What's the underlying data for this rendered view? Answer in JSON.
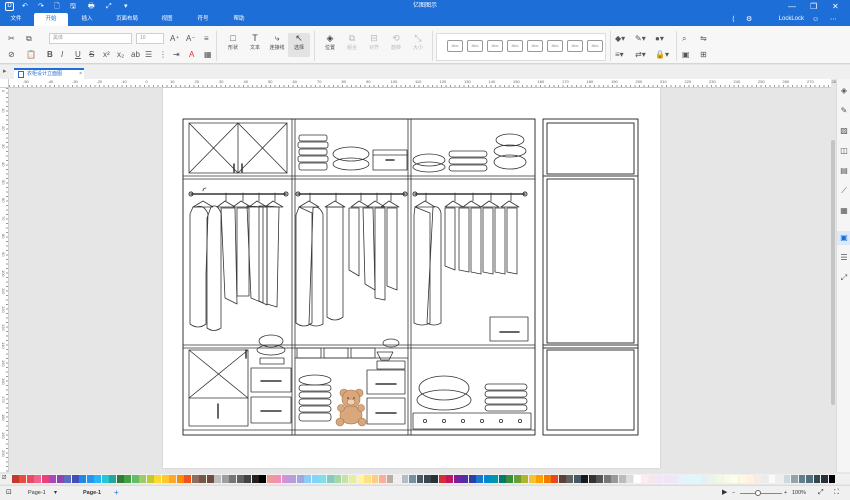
{
  "app": {
    "title": "亿图图示",
    "logo": "D",
    "quick_access": [
      "↶",
      "↷",
      "🗋",
      "🖫",
      "🖶",
      "⤢",
      "▾"
    ]
  },
  "menu": {
    "tabs": [
      "文件",
      "开始",
      "插入",
      "页面布局",
      "视图",
      "符号",
      "帮助"
    ],
    "active": "开始",
    "user": "LockLock",
    "icons": [
      "share-icon",
      "settings-icon",
      "user-icon",
      "apps-icon"
    ]
  },
  "ribbon": {
    "font_family": "黑体",
    "font_size": "10",
    "tools": [
      {
        "label": "形状",
        "icon": "□"
      },
      {
        "label": "文本",
        "icon": "T"
      },
      {
        "label": "连接线",
        "icon": "⤷"
      },
      {
        "label": "选择",
        "icon": "↖"
      },
      {
        "label": "位置",
        "icon": "◈"
      },
      {
        "label": "组合",
        "icon": "⧉"
      },
      {
        "label": "对齐",
        "icon": "⊟"
      },
      {
        "label": "旋转",
        "icon": "⟲"
      },
      {
        "label": "大小",
        "icon": "⤡"
      }
    ],
    "style_presets": [
      "Abc",
      "Abc",
      "Abc",
      "Abc",
      "Abc",
      "Abc",
      "Abc",
      "Abc"
    ]
  },
  "document": {
    "tab_name": "衣柜设计立面图"
  },
  "ruler": {
    "h_labels": [
      "-50",
      "-40",
      "-30",
      "-20",
      "-10",
      "0",
      "10",
      "20",
      "30",
      "40",
      "50",
      "60",
      "70",
      "80",
      "90",
      "100",
      "110",
      "120",
      "130",
      "140",
      "150",
      "160",
      "170",
      "180",
      "190",
      "200",
      "210",
      "220",
      "230",
      "240",
      "250",
      "260",
      "270",
      "280"
    ],
    "v_labels": [
      "0",
      "10",
      "20",
      "30",
      "40",
      "50",
      "60",
      "70",
      "80",
      "90",
      "100",
      "110",
      "120",
      "130",
      "140",
      "150",
      "160",
      "170",
      "180",
      "190",
      "200"
    ]
  },
  "sidebar": {
    "icons": [
      "fill-icon",
      "line-icon",
      "image-icon",
      "layers-icon",
      "page-icon",
      "chart-icon",
      "properties-icon",
      "list-icon",
      "expand-icon"
    ],
    "active_index": 6
  },
  "palette": {
    "colors": [
      "#c0392b",
      "#e74c3c",
      "#e84a5f",
      "#f06292",
      "#ec407a",
      "#ab47bc",
      "#8e44ad",
      "#5c6bc0",
      "#3f51b5",
      "#1e88e5",
      "#2196f3",
      "#29b6f6",
      "#26c6da",
      "#26a69a",
      "#2e7d32",
      "#43a047",
      "#66bb6a",
      "#9ccc65",
      "#c0ca33",
      "#fdd835",
      "#ffca28",
      "#ffa726",
      "#fb8c00",
      "#f4511e",
      "#8d6e63",
      "#795548",
      "#6d4c41",
      "#bdbdbd",
      "#9e9e9e",
      "#757575",
      "#616161",
      "#424242",
      "#212121",
      "#000000",
      "#ef9a9a",
      "#f48fb1",
      "#ce93d8",
      "#b39ddb",
      "#9fa8da",
      "#90caf9",
      "#81d4fa",
      "#80deea",
      "#80cbc4",
      "#a5d6a7",
      "#c5e1a5",
      "#e6ee9c",
      "#fff59d",
      "#ffe082",
      "#ffcc80",
      "#ffab91",
      "#bcaaa4",
      "#eeeeee",
      "#b0bec5",
      "#78909c",
      "#455a64",
      "#37474f",
      "#263238",
      "#d32f2f",
      "#c2185b",
      "#7b1fa2",
      "#512da8",
      "#303f9f",
      "#1976d2",
      "#0288d1",
      "#0097a7",
      "#00796b",
      "#388e3c",
      "#689f38",
      "#afb42b",
      "#fbc02d",
      "#ffa000",
      "#f57c00",
      "#e64a19",
      "#5d4037",
      "#616161",
      "#455a64",
      "#1a1a1a",
      "#333333",
      "#555555",
      "#777777",
      "#999999",
      "#bbbbbb",
      "#dddddd",
      "#ffffff",
      "#ffebee",
      "#fce4ec",
      "#f3e5f5",
      "#ede7f6",
      "#e8eaf6",
      "#e3f2fd",
      "#e1f5fe",
      "#e0f7fa",
      "#e0f2f1",
      "#e8f5e9",
      "#f1f8e9",
      "#f9fbe7",
      "#fffde7",
      "#fff8e1",
      "#fff3e0",
      "#fbe9e7",
      "#efebe9",
      "#fafafa",
      "#eceff1",
      "#cfd8dc",
      "#90a4ae",
      "#607d8b",
      "#546e7a",
      "#37474f",
      "#263238",
      "#000000"
    ]
  },
  "status": {
    "page_selector": "Page-1",
    "page_tab": "Page-1",
    "add": "+",
    "zoom": "100%"
  },
  "colors": {
    "accent": "#1e6ed7",
    "teddy": "#d9a77b"
  }
}
